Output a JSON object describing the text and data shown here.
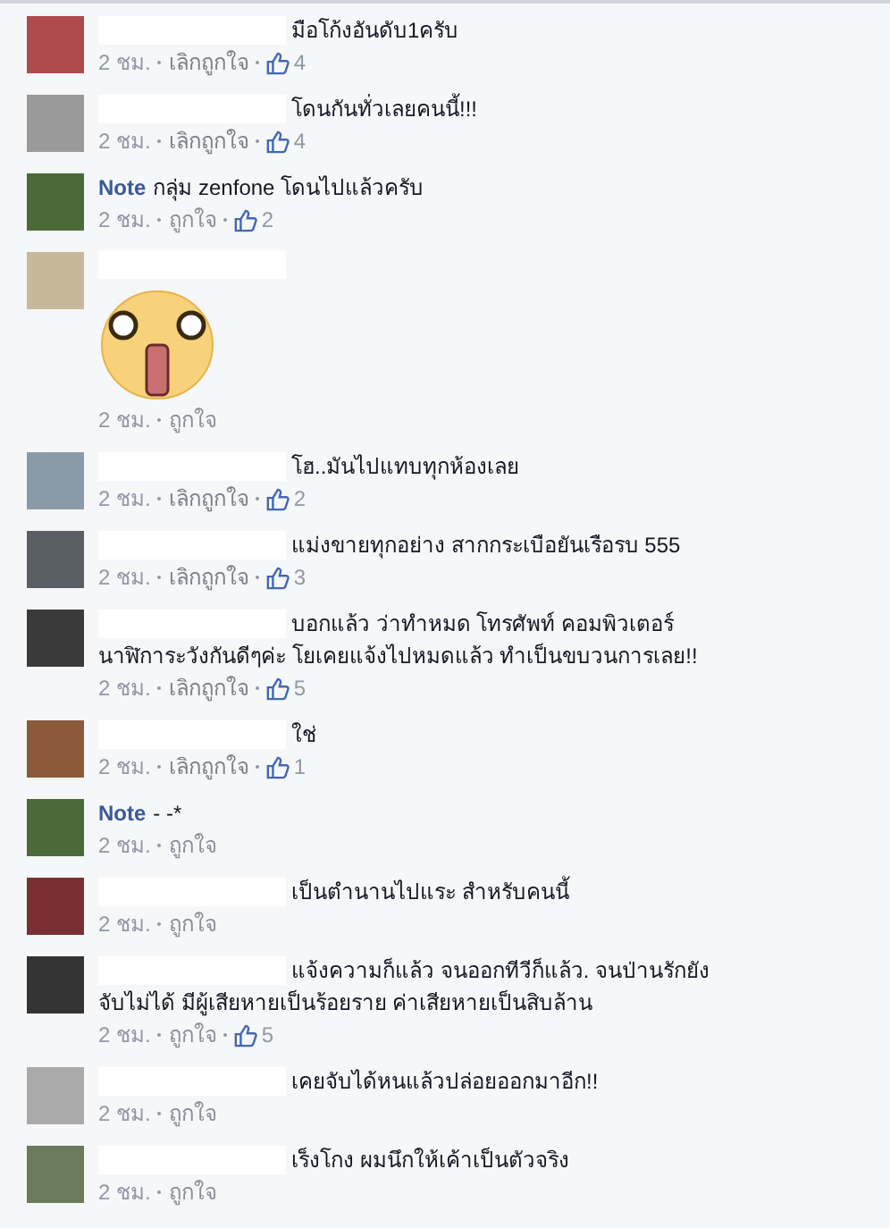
{
  "comments": [
    {
      "author": {
        "kind": "hidden"
      },
      "text": [
        "มือโก้งอันดับ1ครับ"
      ],
      "time": "2 ชม.",
      "like_action": "เลิกถูกใจ",
      "liked": true,
      "likes": "4"
    },
    {
      "author": {
        "kind": "hidden"
      },
      "text": [
        "โดนกันทั่วเลยคนนี้!!!"
      ],
      "time": "2 ชม.",
      "like_action": "เลิกถูกใจ",
      "liked": true,
      "likes": "4"
    },
    {
      "author": {
        "kind": "name",
        "text": "Note"
      },
      "text": [
        "กลุ่ม zenfone โดนไปแล้วครับ"
      ],
      "time": "2 ชม.",
      "like_action": "ถูกใจ",
      "liked": false,
      "likes": "2"
    },
    {
      "author": {
        "kind": "hidden"
      },
      "sticker": true,
      "time": "2 ชม.",
      "like_action": "ถูกใจ",
      "liked": false
    },
    {
      "author": {
        "kind": "hidden"
      },
      "text": [
        "โฮ..มันไปแทบทุกห้องเลย"
      ],
      "time": "2 ชม.",
      "like_action": "เลิกถูกใจ",
      "liked": true,
      "likes": "2"
    },
    {
      "author": {
        "kind": "hidden"
      },
      "text": [
        "แม่งขายทุกอย่าง สากกระเบือยันเรือรบ 555"
      ],
      "time": "2 ชม.",
      "like_action": "เลิกถูกใจ",
      "liked": true,
      "likes": "3"
    },
    {
      "author": {
        "kind": "hidden"
      },
      "text": [
        "บอกแล้ว ว่าทำหมด โทรศัพท์ คอมพิวเตอร์",
        "นาฬิการะวังกันดีๆค่ะ โยเคยแจ้งไปหมดแล้ว ทำเป็นขบวนการเลย!!"
      ],
      "time": "2 ชม.",
      "like_action": "เลิกถูกใจ",
      "liked": true,
      "likes": "5"
    },
    {
      "author": {
        "kind": "hidden"
      },
      "text": [
        "ใช่"
      ],
      "time": "2 ชม.",
      "like_action": "เลิกถูกใจ",
      "liked": true,
      "likes": "1"
    },
    {
      "author": {
        "kind": "name",
        "text": "Note"
      },
      "text": [
        "- -*"
      ],
      "time": "2 ชม.",
      "like_action": "ถูกใจ",
      "liked": false
    },
    {
      "author": {
        "kind": "hidden"
      },
      "text": [
        "เป็นตำนานไปแระ สำหรับคนนี้"
      ],
      "time": "2 ชม.",
      "like_action": "ถูกใจ",
      "liked": false
    },
    {
      "author": {
        "kind": "hidden"
      },
      "text": [
        "แจ้งความก็แล้ว จนออกทีวีก็แล้ว. จนป่านรักยัง",
        "จับไม่ได้ มีผู้เสียหายเป็นร้อยราย ค่าเสียหายเป็นสิบล้าน"
      ],
      "time": "2 ชม.",
      "like_action": "ถูกใจ",
      "liked": false,
      "likes": "5"
    },
    {
      "author": {
        "kind": "hidden"
      },
      "text": [
        "เคยจับได้หนแล้วปล่อยออกมาอีก!!"
      ],
      "time": "2 ชม.",
      "like_action": "ถูกใจ",
      "liked": false
    },
    {
      "author": {
        "kind": "hidden"
      },
      "text": [
        "เร็งโกง ผมนึกให้เค้าเป็นตัวจริง"
      ],
      "time": "2 ชม.",
      "like_action": "ถูกใจ",
      "liked": false
    }
  ]
}
